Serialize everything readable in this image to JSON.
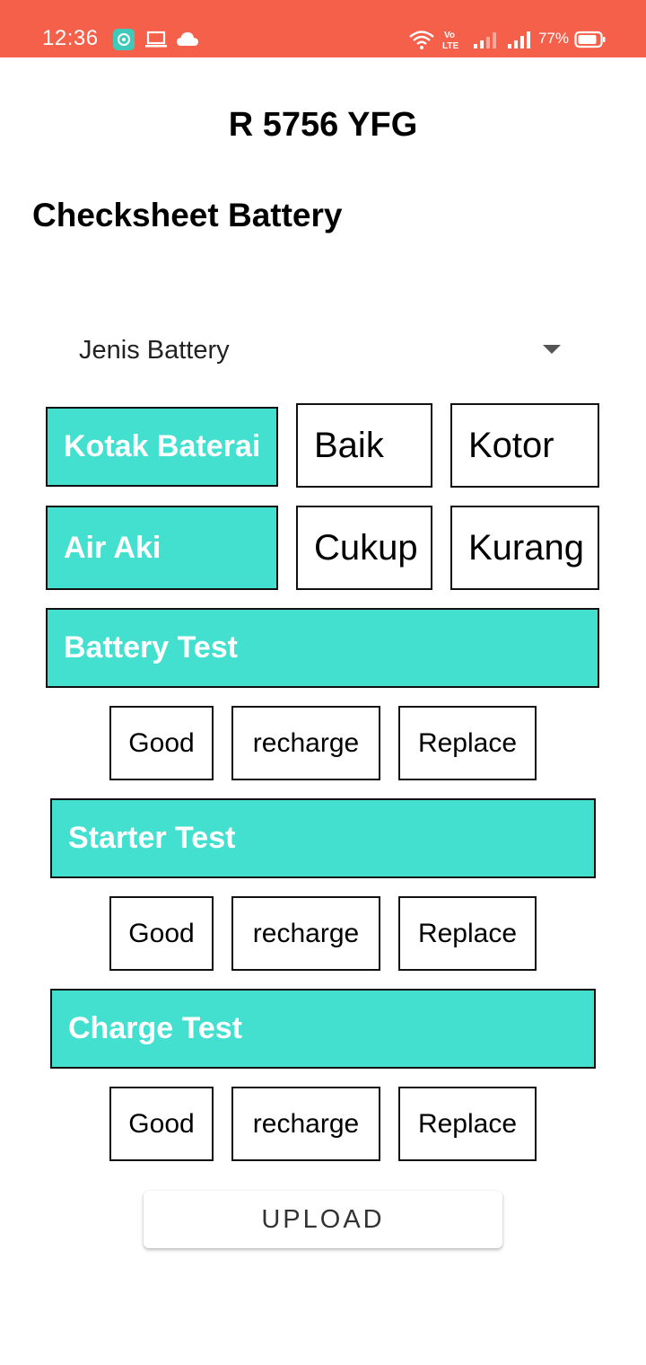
{
  "status_bar": {
    "time": "12:36",
    "battery_percent": "77%",
    "network_label": "Vo LTE",
    "color": "#f5604b"
  },
  "vehicle_plate": "R 5756 YFG",
  "page_title": "Checksheet Battery",
  "battery_type_dropdown": {
    "label": "Jenis Battery"
  },
  "rows": {
    "kotak_baterai": {
      "label": "Kotak Baterai",
      "options": [
        "Baik",
        "Kotor"
      ]
    },
    "air_aki": {
      "label": "Air Aki",
      "options": [
        "Cukup",
        "Kurang"
      ]
    }
  },
  "tests": [
    {
      "label": "Battery Test",
      "options": [
        "Good",
        "recharge",
        "Replace"
      ]
    },
    {
      "label": "Starter Test",
      "options": [
        "Good",
        "recharge",
        "Replace"
      ]
    },
    {
      "label": "Charge Test",
      "options": [
        "Good",
        "recharge",
        "Replace"
      ]
    }
  ],
  "upload_button": "UPLOAD",
  "accent_color": "#43e0cf"
}
